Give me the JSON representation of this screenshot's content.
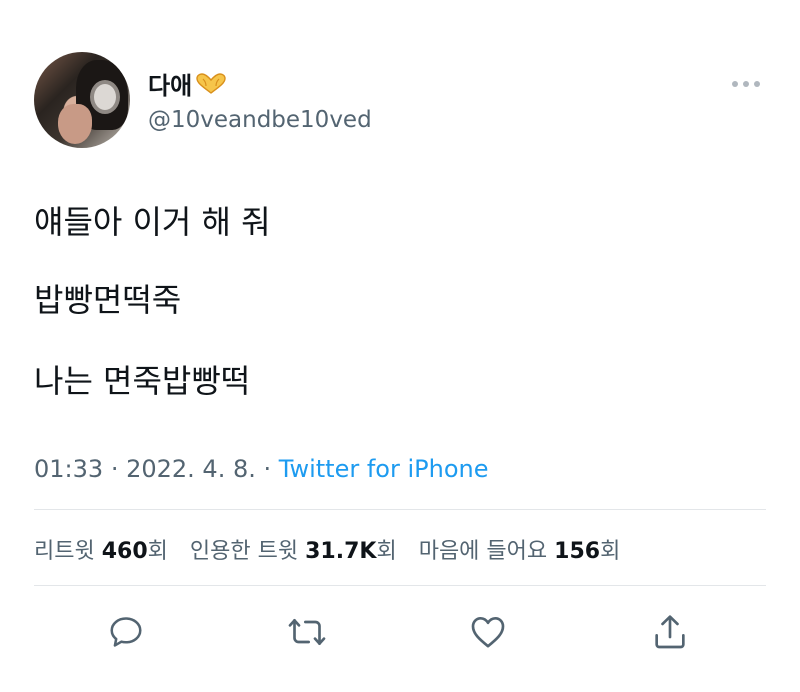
{
  "user": {
    "display_name": "다애",
    "handle": "@10veandbe10ved",
    "avatar_icon": "profile-photo",
    "name_emoji_icon": "heart-hands-icon"
  },
  "tweet": {
    "lines": [
      "얘들아 이거 해 줘",
      "밥빵면떡죽",
      "나는 면죽밥빵떡"
    ],
    "time": "01:33",
    "date": "2022. 4. 8.",
    "separator": "·",
    "source": "Twitter for iPhone"
  },
  "stats": {
    "retweets_label": "리트윗",
    "retweets_count": "460",
    "retweets_unit": "회",
    "quotes_label": "인용한 트윗",
    "quotes_count": "31.7K",
    "quotes_unit": "회",
    "likes_label": "마음에 들어요",
    "likes_count": "156",
    "likes_unit": "회"
  },
  "actions": [
    "reply-icon",
    "retweet-icon",
    "like-icon",
    "share-icon"
  ],
  "colors": {
    "link": "#1d9bf0",
    "secondary": "#536471",
    "text": "#0f1419",
    "divider": "#e3e6e9"
  }
}
